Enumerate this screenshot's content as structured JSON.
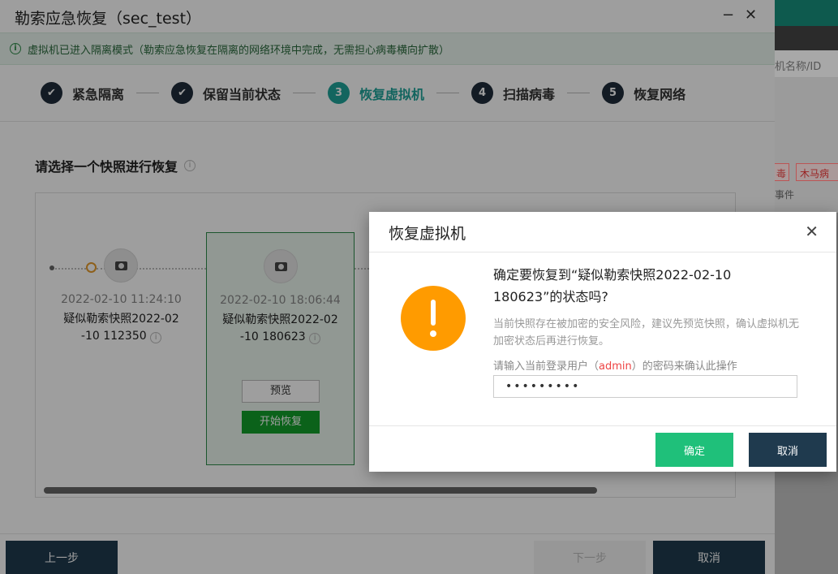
{
  "background_page": {
    "search_text": "机名称/ID",
    "tag1": "毒",
    "tag2": "木马病",
    "event_label": "事件"
  },
  "wizard": {
    "title": "勒索应急恢复（sec_test）",
    "minimize": "−",
    "close": "✕",
    "notice": "虚拟机已进入隔离模式（勒索应急恢复在隔离的网络环境中完成，无需担心病毒横向扩散）",
    "steps": [
      {
        "num": "✔",
        "label": "紧急隔离"
      },
      {
        "num": "✔",
        "label": "保留当前状态"
      },
      {
        "num": "3",
        "label": "恢复虚拟机"
      },
      {
        "num": "4",
        "label": "扫描病毒"
      },
      {
        "num": "5",
        "label": "恢复网络"
      }
    ],
    "section_title": "请选择一个快照进行恢复",
    "snapshots": [
      {
        "time": "2022-02-10 11:24:10",
        "name_line1": "疑似勒索快照2022-02",
        "name_line2": "-10 112350"
      },
      {
        "time": "2022-02-10 18:06:44",
        "name_line1": "疑似勒索快照2022-02",
        "name_line2": "-10 180623",
        "preview": "预览",
        "start": "开始恢复"
      }
    ],
    "footer": {
      "prev": "上一步",
      "next": "下一步",
      "cancel": "取消"
    }
  },
  "modal": {
    "title": "恢复虚拟机",
    "question": "确定要恢复到“疑似勒索快照2022-02-10 180623”的状态吗?",
    "description": "当前快照存在被加密的安全风险，建议先预览快照，确认虚拟机无加密状态后再进行恢复。",
    "pw_label_pre": "请输入当前登录用户（",
    "pw_user": "admin",
    "pw_label_post": "）的密码来确认此操作",
    "password_value": "•••••••••",
    "ok": "确定",
    "cancel": "取消"
  },
  "colors": {
    "accent": "#1fa39a",
    "ok": "#1fc07a",
    "dark": "#1f3a4e",
    "warning": "#ff9b00",
    "start_button": "#129f2a"
  }
}
